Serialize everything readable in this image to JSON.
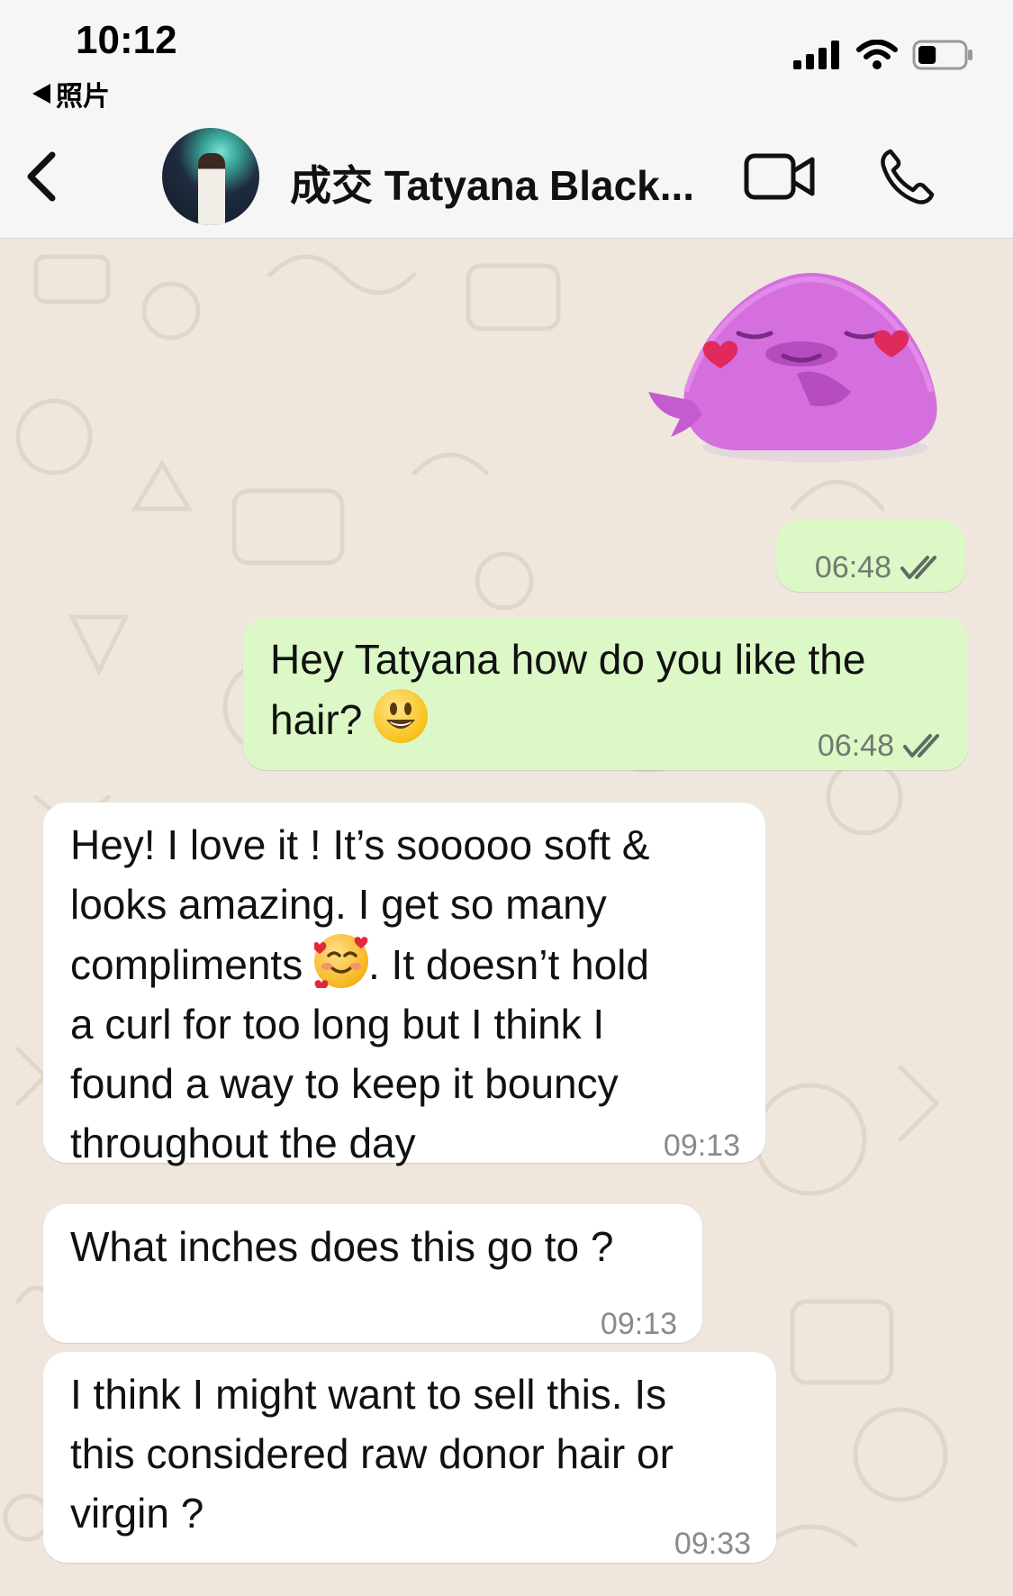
{
  "status_bar": {
    "time": "10:12",
    "back_app": "照片",
    "back_icon": "small-left-triangle-icon",
    "signal_icon": "cellular-signal-icon",
    "wifi_icon": "wifi-icon",
    "battery_icon": "battery-icon",
    "battery_level": 0.4
  },
  "header": {
    "contact_name": "成交 Tatyana Black...",
    "back_icon": "chevron-left-icon",
    "video_icon": "video-camera-icon",
    "call_icon": "phone-icon"
  },
  "messages": [
    {
      "direction": "out",
      "type": "sticker",
      "time": "06:48",
      "read": true
    },
    {
      "direction": "out",
      "type": "text",
      "text": "Hey Tatyana how do you like the hair?",
      "emoji": "grinning-face",
      "time": "06:48",
      "read": true
    },
    {
      "direction": "in",
      "type": "text",
      "lines": [
        "Hey! I love it ! It’s sooooo soft &",
        "looks amazing. I get so many",
        "compliments",
        ". It doesn’t hold",
        "a curl for too long but I think I",
        "found a way to keep it bouncy",
        "throughout the day"
      ],
      "emoji": "smiling-face-with-hearts",
      "time": "09:13"
    },
    {
      "direction": "in",
      "type": "text",
      "text": "What inches does this go to ?",
      "time": "09:13"
    },
    {
      "direction": "in",
      "type": "text",
      "lines": [
        "I think I might want to sell this. Is",
        "this considered raw donor hair or",
        "virgin ?"
      ],
      "time": "09:33"
    }
  ],
  "colors": {
    "outgoing_bubble": "#dcf8c6",
    "incoming_bubble": "#ffffff",
    "chat_background": "#efe7dd",
    "read_ticks": "#5f6b63"
  }
}
